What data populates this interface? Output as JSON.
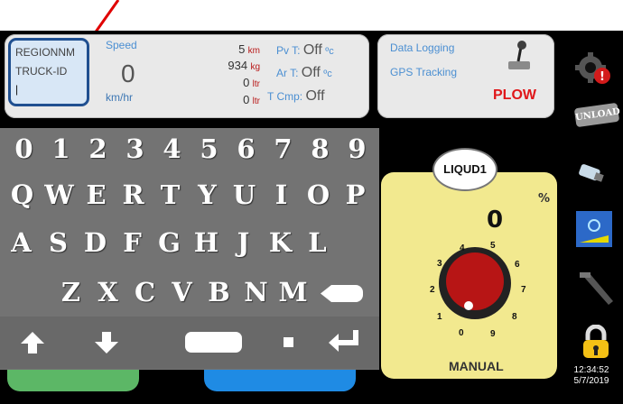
{
  "annotation": {
    "arrow_color": "#e00000"
  },
  "region": {
    "line1": "REGIONNM",
    "line2": "TRUCK-ID",
    "cursor": "|"
  },
  "speed": {
    "label": "Speed",
    "value": "0",
    "unit": "km/hr"
  },
  "distance": {
    "value": "5",
    "unit": "km"
  },
  "weight": {
    "value": "934",
    "unit": "kg"
  },
  "liters": [
    {
      "value": "0",
      "unit": "ltr"
    },
    {
      "value": "0",
      "unit": "ltr"
    }
  ],
  "temps": [
    {
      "label": "Pv T:",
      "value": "Off",
      "unit": "ºc"
    },
    {
      "label": "Ar T:",
      "value": "Off",
      "unit": "ºc"
    },
    {
      "label": "T Cmp:",
      "value": "Off"
    }
  ],
  "logging": {
    "data_logging": "Data Logging",
    "gps_tracking": "GPS Tracking",
    "mode": "PLOW"
  },
  "keyboard": {
    "row1": [
      "0",
      "1",
      "2",
      "3",
      "4",
      "5",
      "6",
      "7",
      "8",
      "9"
    ],
    "row2": [
      "Q",
      "W",
      "E",
      "R",
      "T",
      "Y",
      "U",
      "I",
      "O",
      "P"
    ],
    "row3": [
      "A",
      "S",
      "D",
      "F",
      "G",
      "H",
      "J",
      "K",
      "L"
    ],
    "row4": [
      "Z",
      "X",
      "C",
      "V",
      "B",
      "N",
      "M"
    ],
    "controls": [
      "up-arrow",
      "down-arrow",
      "space",
      "dot",
      "enter"
    ]
  },
  "material": {
    "name": "LIQUD1",
    "percent_label": "%",
    "value": "0",
    "dial_labels": [
      "0",
      "1",
      "2",
      "3",
      "4",
      "5",
      "6",
      "7",
      "8",
      "9"
    ],
    "mode": "MANUAL"
  },
  "sidebar": {
    "unload": "UNLOAD"
  },
  "clock": {
    "time": "12:34:52",
    "date": "5/7/2019"
  },
  "colors": {
    "keyboard": "#737373",
    "panel_yellow": "#f2e98f",
    "dial_red": "#b71515",
    "accent_blue": "#2c69c8"
  }
}
